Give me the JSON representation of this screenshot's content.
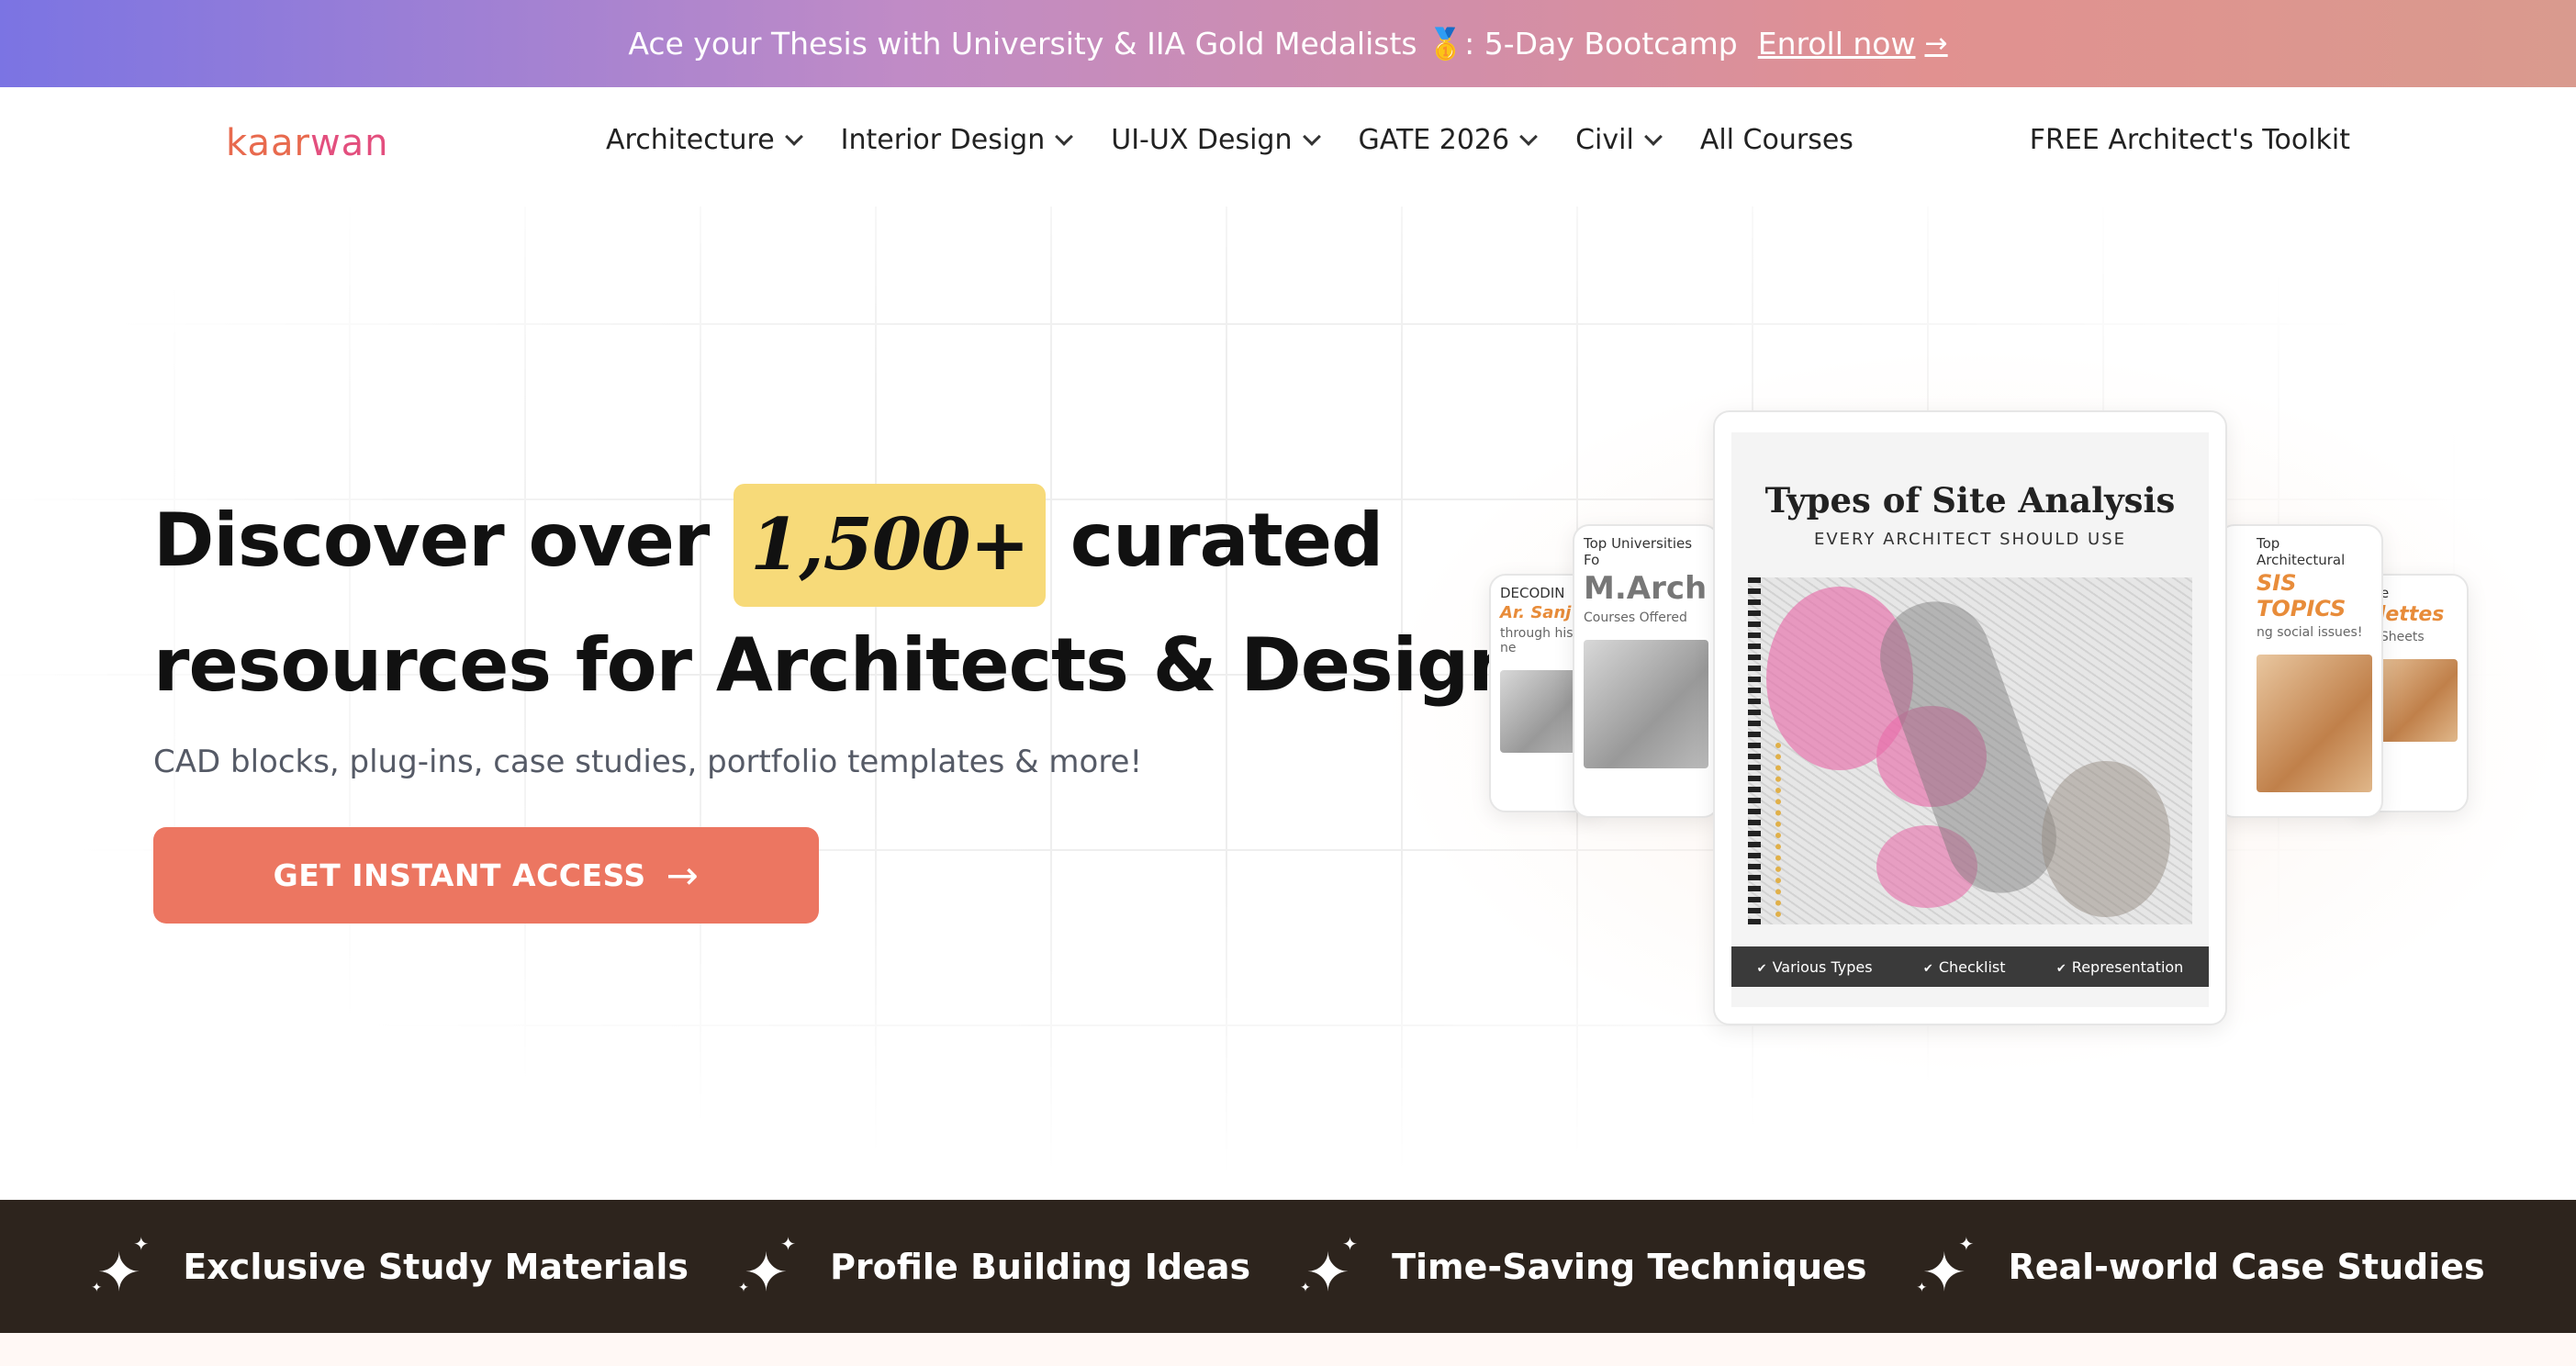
{
  "announcement": {
    "text": "Ace your Thesis with University & IIA Gold Medalists 🥇: 5-Day Bootcamp",
    "link_label": "Enroll now",
    "link_arrow": "→"
  },
  "brand": {
    "logo_part1": "kaar",
    "logo_part2": "wan"
  },
  "nav": {
    "items": [
      {
        "label": "Architecture"
      },
      {
        "label": "Interior Design"
      },
      {
        "label": "UI-UX Design"
      },
      {
        "label": "GATE 2026"
      },
      {
        "label": "Civil"
      },
      {
        "label": "All Courses"
      }
    ],
    "toolkit_label": "FREE Architect's Toolkit"
  },
  "hero": {
    "headline_part1": "Discover over",
    "highlight": "1,500+",
    "headline_part2": "curated",
    "headline_line2": "resources for Architects & Designers",
    "subheadline": "CAD blocks, plug-ins, case studies, portfolio templates & more!",
    "cta_label": "GET INSTANT ACCESS",
    "cta_arrow": "→"
  },
  "cards": {
    "main": {
      "title": "Types of Site Analysis",
      "subtitle": "EVERY ARCHITECT SHOULD USE",
      "footer": [
        "Various Types",
        "Checklist",
        "Representation"
      ]
    },
    "left1": {
      "title": "DECODIN",
      "name": "Ar. Sanj",
      "text": "through his ne"
    },
    "left2": {
      "title": "Top Universities Fo",
      "big": "M.Arch",
      "text": "Courses Offered"
    },
    "right1": {
      "title": "Top Architectural",
      "big": "SIS TOPICS",
      "text": "ng social issues!"
    },
    "right2": {
      "title": "ese",
      "big": "alettes",
      "text": "al Sheets"
    }
  },
  "features": [
    {
      "label": "Exclusive Study Materials",
      "icon": "sparkle-icon"
    },
    {
      "label": "Profile Building Ideas",
      "icon": "sparkle-icon"
    },
    {
      "label": "Time-Saving Techniques",
      "icon": "sparkle-icon"
    },
    {
      "label": "Real-world Case Studies",
      "icon": "sparkle-icon"
    }
  ],
  "colors": {
    "cta": "#ec7661",
    "highlight": "#f7da79",
    "strip": "#2d241d",
    "logo_orange": "#e86a4e",
    "logo_pink": "#e34f7e"
  }
}
